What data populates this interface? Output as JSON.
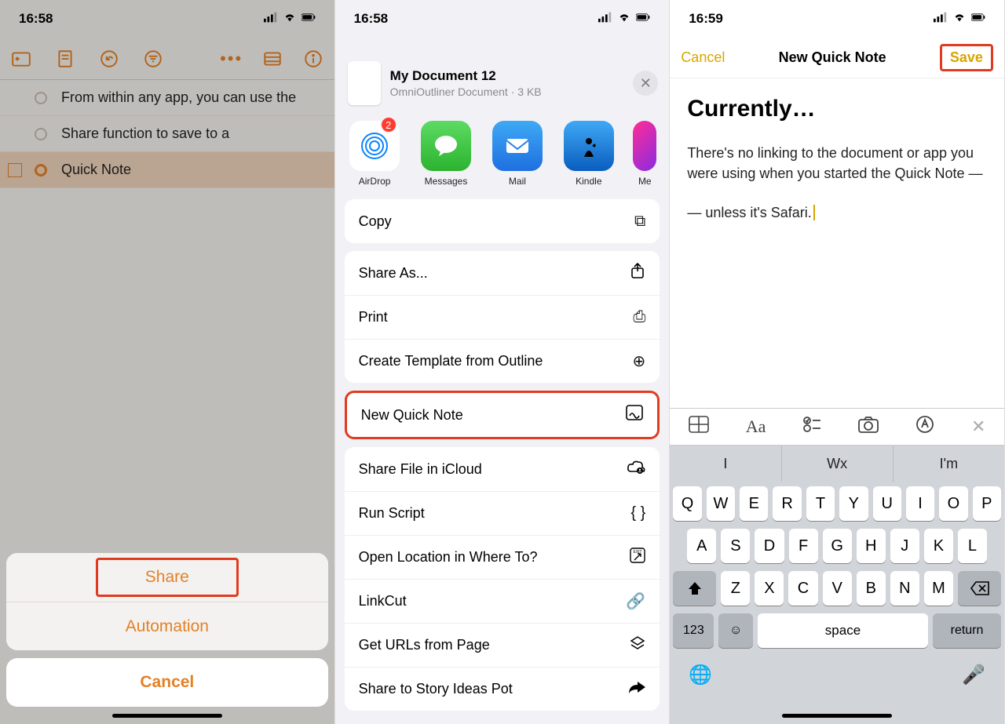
{
  "phone1": {
    "time": "16:58",
    "rows": [
      "From within any app, you can use the",
      "Share function to save to a",
      "Quick Note"
    ],
    "sheet": {
      "share": "Share",
      "automation": "Automation",
      "cancel": "Cancel"
    }
  },
  "phone2": {
    "time": "16:58",
    "doc": {
      "title": "My Document 12",
      "sub": "OmniOutliner Document · 3 KB"
    },
    "apps": [
      {
        "label": "AirDrop",
        "badge": "2"
      },
      {
        "label": "Messages"
      },
      {
        "label": "Mail"
      },
      {
        "label": "Kindle"
      },
      {
        "label": "Me"
      }
    ],
    "groups": [
      [
        {
          "label": "Copy",
          "icon": "⧉"
        }
      ],
      [
        {
          "label": "Share As...",
          "icon": "↑"
        },
        {
          "label": "Print",
          "icon": "⎙"
        },
        {
          "label": "Create Template from Outline",
          "icon": "⊕"
        }
      ],
      [
        {
          "label": "New Quick Note",
          "icon": "✎"
        }
      ],
      [
        {
          "label": "Share File in iCloud",
          "icon": "☁"
        },
        {
          "label": "Run Script",
          "icon": "{ }"
        },
        {
          "label": "Open Location in Where To?",
          "icon": "⎋"
        },
        {
          "label": "LinkCut",
          "icon": "🔗"
        },
        {
          "label": "Get URLs from Page",
          "icon": "◇"
        },
        {
          "label": "Share to Story Ideas Pot",
          "icon": "➦"
        }
      ]
    ]
  },
  "phone3": {
    "time": "16:59",
    "nav": {
      "cancel": "Cancel",
      "title": "New Quick Note",
      "save": "Save"
    },
    "heading": "Currently…",
    "para1": "There's no linking to the document or app you were using when you started the Quick Note —",
    "para2": "— unless it's Safari.",
    "suggestions": [
      "I",
      "Wx",
      "I'm"
    ],
    "keys_row1": [
      "Q",
      "W",
      "E",
      "R",
      "T",
      "Y",
      "U",
      "I",
      "O",
      "P"
    ],
    "keys_row2": [
      "A",
      "S",
      "D",
      "F",
      "G",
      "H",
      "J",
      "K",
      "L"
    ],
    "keys_row3": [
      "Z",
      "X",
      "C",
      "V",
      "B",
      "N",
      "M"
    ],
    "key_123": "123",
    "key_space": "space",
    "key_return": "return"
  }
}
